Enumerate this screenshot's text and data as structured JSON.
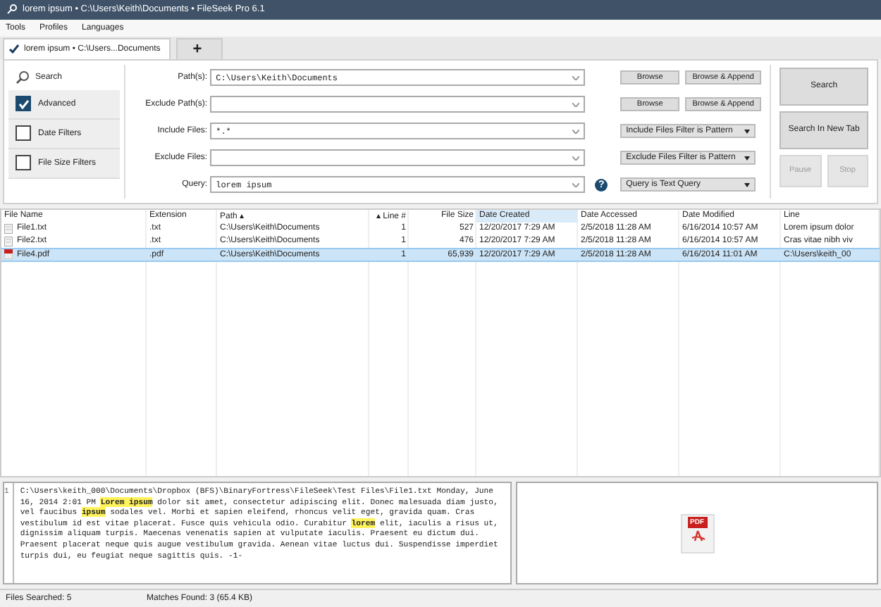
{
  "window": {
    "title": "lorem ipsum • C:\\Users\\Keith\\Documents • FileSeek Pro 6.1"
  },
  "menu": [
    "Tools",
    "Profiles",
    "Languages"
  ],
  "tabs": [
    {
      "label": "lorem ipsum • C:\\Users...Documents",
      "selected": true
    },
    {
      "label": "+",
      "selected": false
    }
  ],
  "sidebar": {
    "search_label": "Search",
    "items": [
      {
        "label": "Advanced",
        "checked": true
      },
      {
        "label": "Date Filters",
        "checked": false
      },
      {
        "label": "File Size Filters",
        "checked": false
      }
    ]
  },
  "fields": [
    {
      "label": "Path(s):",
      "value": "C:\\Users\\Keith\\Documents",
      "kind": "buttons",
      "buttons": [
        "Browse",
        "Browse & Append"
      ]
    },
    {
      "label": "Exclude Path(s):",
      "kind": "buttons",
      "buttons": [
        "Browse",
        "Browse & Append"
      ]
    },
    {
      "label": "Include Files:",
      "value": "*.*",
      "kind": "select",
      "option": "Include Files Filter is Pattern"
    },
    {
      "label": "Exclude Files:",
      "kind": "select",
      "option": "Exclude Files Filter is Pattern"
    },
    {
      "label": "Query:",
      "value": "lorem ipsum",
      "kind": "help",
      "help": "?",
      "option": "Query is Text Query"
    }
  ],
  "actions": [
    {
      "label": "Search",
      "disabled": false
    },
    {
      "label": "Search In New Tab",
      "disabled": false
    },
    {
      "label": "Pause",
      "disabled": true
    },
    {
      "label": "Stop",
      "disabled": true
    }
  ],
  "table": {
    "columns": [
      {
        "label": "File Name",
        "highlighted": false
      },
      {
        "label": "Extension",
        "highlighted": false
      },
      {
        "label": "Path ▴",
        "highlighted": false
      },
      {
        "label": "▴ Line #",
        "highlighted": false
      },
      {
        "label": "File Size",
        "highlighted": false
      },
      {
        "label": "Date Created",
        "highlighted": true
      },
      {
        "label": "Date Accessed",
        "highlighted": false
      },
      {
        "label": "Date Modified",
        "highlighted": false
      },
      {
        "label": "Line",
        "highlighted": false
      }
    ],
    "rows": [
      {
        "kind": "text",
        "selected": false,
        "cells": [
          "File1.txt",
          ".txt",
          "C:\\Users\\Keith\\Documents",
          "1",
          "527",
          "12/20/2017 7:29 AM",
          "2/5/2018 11:28 AM",
          "6/16/2014 10:57 AM",
          "Lorem ipsum dolor"
        ]
      },
      {
        "kind": "text",
        "selected": false,
        "cells": [
          "File2.txt",
          ".txt",
          "C:\\Users\\Keith\\Documents",
          "1",
          "476",
          "12/20/2017 7:29 AM",
          "2/5/2018 11:28 AM",
          "6/16/2014 10:57 AM",
          "Cras vitae nibh viv"
        ]
      },
      {
        "kind": "pdf",
        "selected": true,
        "cells": [
          "File4.pdf",
          ".pdf",
          "C:\\Users\\Keith\\Documents",
          "1",
          "65,939",
          "12/20/2017 7:29 AM",
          "2/5/2018 11:28 AM",
          "6/16/2014 11:01 AM",
          "C:\\Users\\keith_00"
        ]
      }
    ]
  },
  "preview": {
    "line_number": "1",
    "text": "C:\\Users\\keith_000\\Documents\\Dropbox (BFS)\\BinaryFortress\\FileSeek\\Test Files\\File1.txt Monday, June 16, 2014 2:01 PM **Lorem ipsum** dolor sit amet, consectetur adipiscing elit. Donec malesuada diam justo, vel faucibus **ipsum** sodales vel. Morbi et sapien eleifend, rhoncus velit eget, gravida quam. Cras vestibulum id est vitae placerat. Fusce quis vehicula odio. Curabitur **lorem** elit, iaculis a risus ut, dignissim aliquam turpis. Maecenas venenatis sapien at vulputate iaculis. Praesent eu dictum dui. Praesent placerat neque quis augue vestibulum gravida. Aenean vitae luctus dui. Suspendisse imperdiet turpis dui, eu feugiat neque sagittis quis. -1-",
    "file_icon": "PDF"
  },
  "status_bar": [
    "Files Searched: 5",
    "Matches Found: 3 (65.4 KB)"
  ]
}
